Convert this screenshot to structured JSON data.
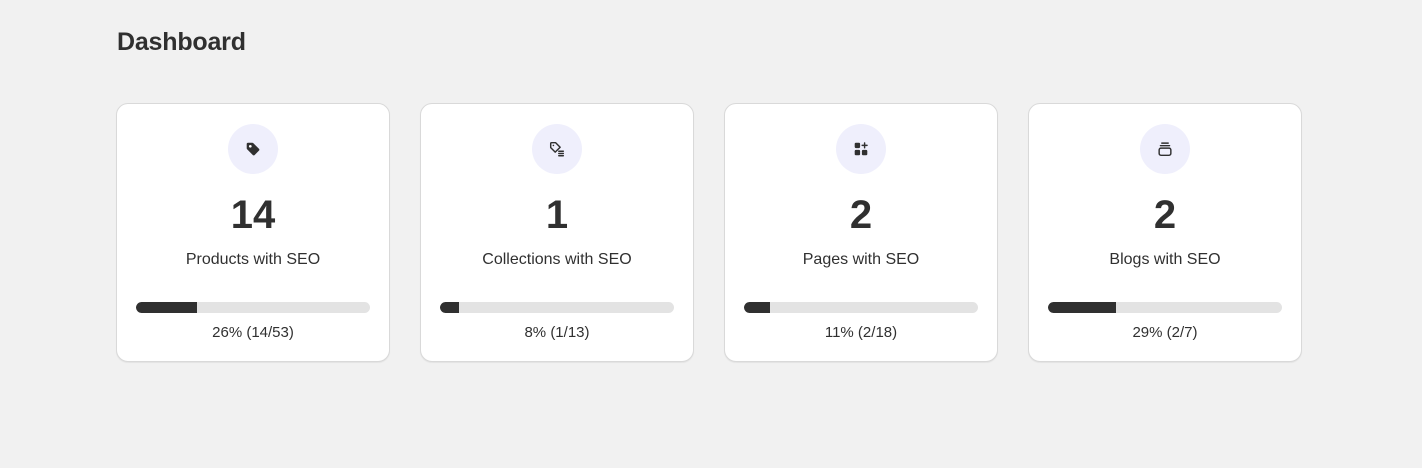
{
  "page": {
    "title": "Dashboard"
  },
  "colors": {
    "background": "#f1f1f1",
    "card": "#ffffff",
    "icon_circle": "#efeffc",
    "progress_fill": "#303030",
    "progress_track": "#e3e3e3",
    "text": "#303030"
  },
  "cards": [
    {
      "icon": "tag-icon",
      "count": "14",
      "label": "Products with SEO",
      "progress_percent": 26,
      "progress_text": "26% (14/53)"
    },
    {
      "icon": "collection-tag-list-icon",
      "count": "1",
      "label": "Collections with SEO",
      "progress_percent": 8,
      "progress_text": "8% (1/13)"
    },
    {
      "icon": "page-add-grid-icon",
      "count": "2",
      "label": "Pages with SEO",
      "progress_percent": 11,
      "progress_text": "11% (2/18)"
    },
    {
      "icon": "blog-stack-icon",
      "count": "2",
      "label": "Blogs with SEO",
      "progress_percent": 29,
      "progress_text": "29% (2/7)"
    }
  ]
}
